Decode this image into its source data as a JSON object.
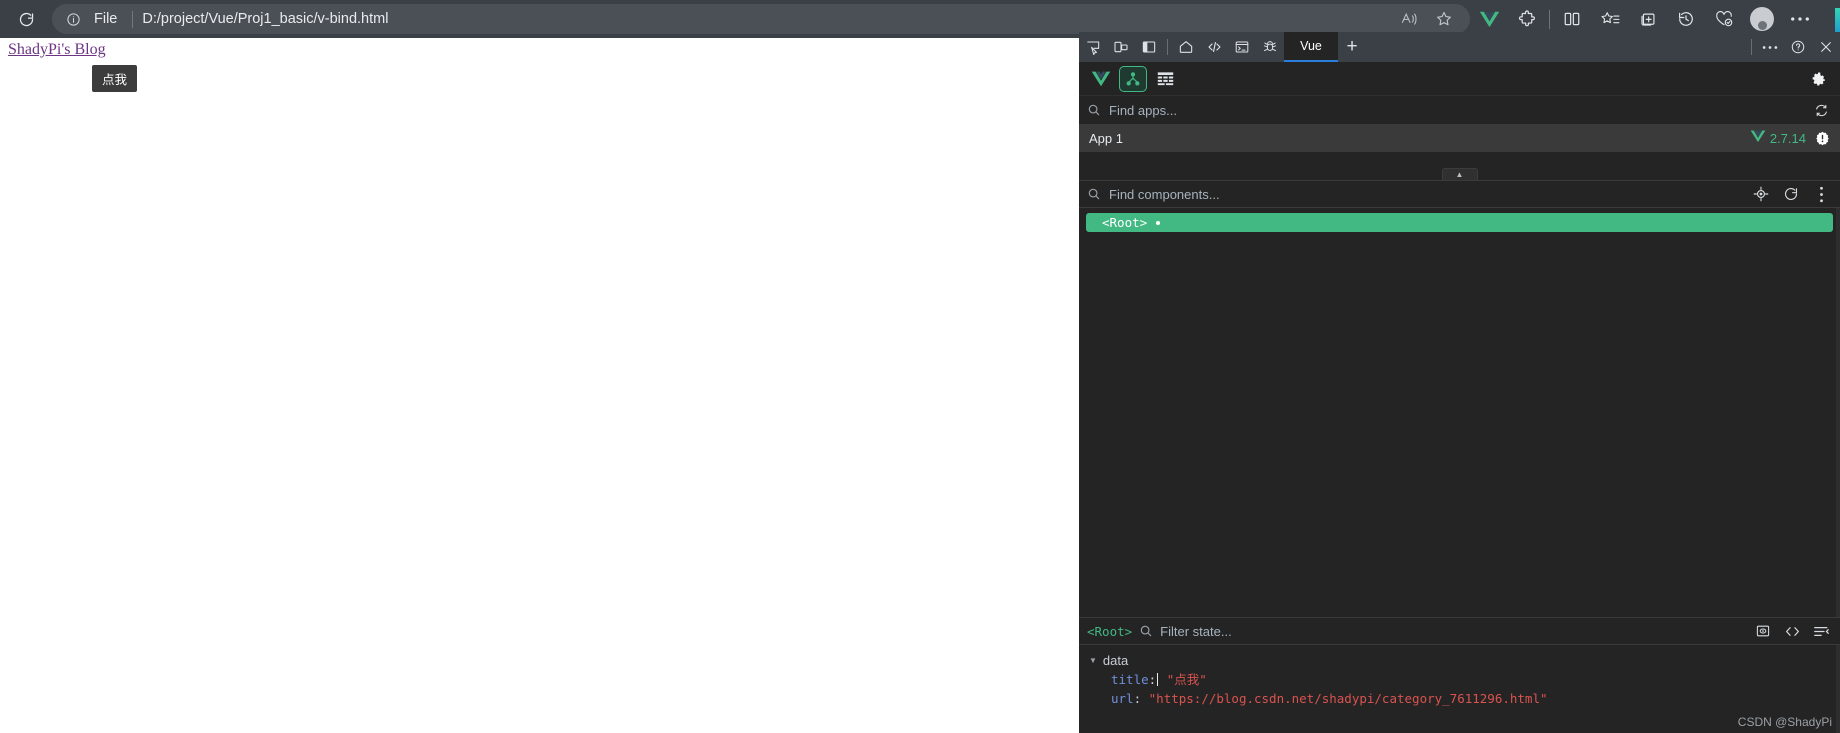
{
  "browser": {
    "reload_icon": "reload-icon",
    "info_icon": "info-icon",
    "file_label": "File",
    "url": "D:/project/Vue/Proj1_basic/v-bind.html",
    "address_icons": [
      {
        "name": "read-aloud-icon"
      },
      {
        "name": "favorite-star-icon"
      }
    ],
    "toolbar_icons": [
      {
        "name": "vue-devtools-extension-icon"
      },
      {
        "name": "extensions-puzzle-icon"
      },
      {
        "name": "split-screen-icon"
      },
      {
        "name": "favorites-list-icon"
      },
      {
        "name": "collections-add-icon"
      },
      {
        "name": "history-icon"
      },
      {
        "name": "browser-essentials-icon"
      },
      {
        "name": "profile-avatar-icon"
      },
      {
        "name": "settings-more-icon"
      }
    ]
  },
  "page": {
    "blog_link_text": "ShadyPi's Blog",
    "button_label": "点我"
  },
  "devtools": {
    "tabbar": {
      "left_icons": [
        {
          "name": "inspect-element-icon"
        },
        {
          "name": "device-toolbar-icon"
        },
        {
          "name": "dock-side-icon"
        }
      ],
      "panel_icons": [
        {
          "name": "welcome-home-icon"
        },
        {
          "name": "elements-code-icon"
        },
        {
          "name": "console-icon"
        },
        {
          "name": "sources-debugger-icon"
        }
      ],
      "active_tab": "Vue",
      "add_tab_label": "+",
      "right_icons": [
        {
          "name": "more-options-icon"
        },
        {
          "name": "help-question-icon"
        },
        {
          "name": "close-devtools-icon"
        }
      ]
    },
    "vue_toolbar": {
      "logo_icon": "vue-logo-icon",
      "components_tab_icon": "component-tree-icon",
      "timeline_tab_icon": "timeline-icon",
      "settings_icon": "settings-gear-icon"
    },
    "app_search": {
      "placeholder": "Find apps...",
      "search_icon": "search-icon",
      "refresh_icon": "refresh-apps-icon"
    },
    "app_row": {
      "name": "App 1",
      "vue_logo_icon": "vue-logo-icon",
      "version": "2.7.14",
      "badge_icon": "warning-badge-icon"
    },
    "collapse_handle_icon": "collapse-chevron-up-icon",
    "component_search": {
      "placeholder": "Find components...",
      "search_icon": "search-icon",
      "select_icon": "select-component-crosshair-icon",
      "refresh_icon": "refresh-tree-icon",
      "menu_icon": "kebab-menu-icon"
    },
    "tree": {
      "nodes": [
        {
          "label": "<Root>",
          "selected": true,
          "has_marker": true
        }
      ]
    },
    "inspector": {
      "component_name": "<Root>",
      "filter_placeholder": "Filter state...",
      "search_icon": "search-icon",
      "icons": [
        {
          "name": "inspect-dom-icon"
        },
        {
          "name": "open-in-editor-icon"
        },
        {
          "name": "state-format-icon"
        }
      ]
    },
    "state": {
      "section_label": "data",
      "caret_icon": "caret-down-icon",
      "entries": [
        {
          "key": "title",
          "value": "\"点我\"",
          "editing": true
        },
        {
          "key": "url",
          "value": "\"https://blog.csdn.net/shadypi/category_7611296.html\"",
          "editing": false
        }
      ]
    },
    "watermark": "CSDN @ShadyPi"
  },
  "colors": {
    "vue_green": "#42b883",
    "tab_accent": "#2a7fdd",
    "link_purple": "#6c3483",
    "value_red": "#d9534f",
    "key_blue": "#6f8fd8"
  }
}
